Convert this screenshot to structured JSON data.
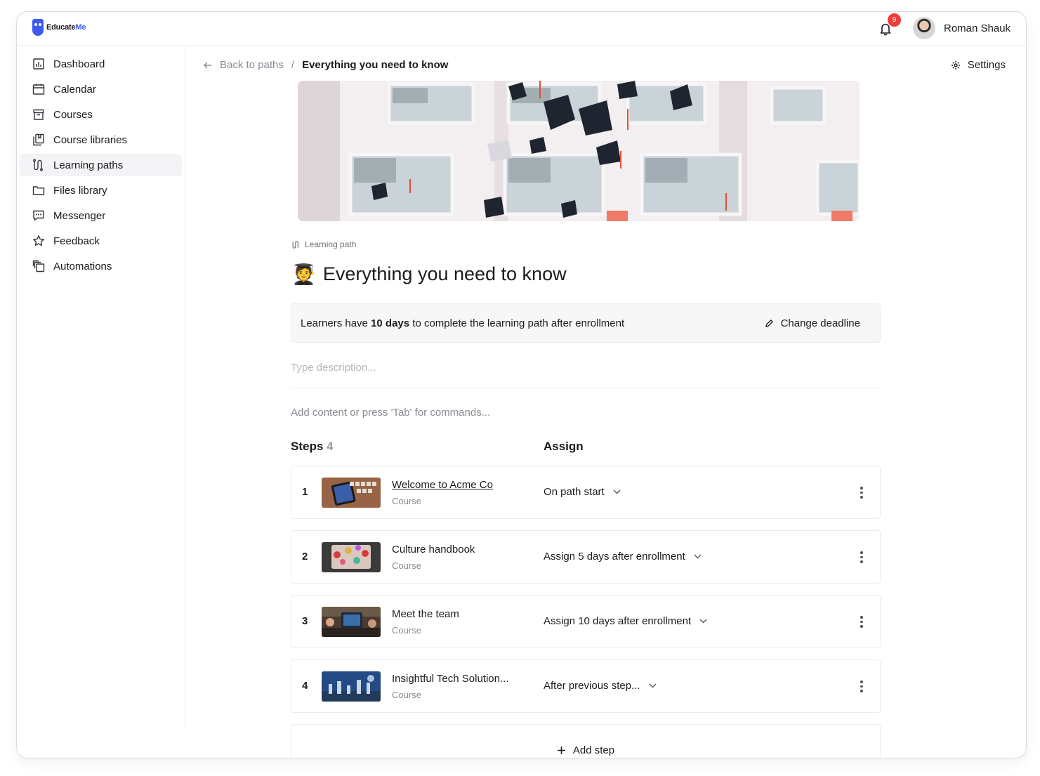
{
  "app": {
    "logo_text_main": "Educate",
    "logo_text_accent": "Me",
    "notifications_count": "9",
    "user_name": "Roman Shauk"
  },
  "sidebar": {
    "items": [
      {
        "label": "Dashboard",
        "icon": "dashboard-icon"
      },
      {
        "label": "Calendar",
        "icon": "calendar-icon"
      },
      {
        "label": "Courses",
        "icon": "courses-icon"
      },
      {
        "label": "Course libraries",
        "icon": "library-icon"
      },
      {
        "label": "Learning paths",
        "icon": "path-icon",
        "active": true
      },
      {
        "label": "Files library",
        "icon": "folder-icon"
      },
      {
        "label": "Messenger",
        "icon": "chat-icon"
      },
      {
        "label": "Feedback",
        "icon": "star-icon"
      },
      {
        "label": "Automations",
        "icon": "automation-icon"
      }
    ]
  },
  "breadcrumb": {
    "back_label": "Back to paths",
    "separator": "/",
    "current": "Everything you need to know"
  },
  "settings_label": "Settings",
  "path": {
    "tag": "Learning path",
    "emoji": "🧑‍🎓",
    "title": "Everything you need to know",
    "deadline_prefix": "Learners have ",
    "deadline_value": "10 days",
    "deadline_suffix": " to complete the learning path after enrollment",
    "change_deadline_label": "Change deadline",
    "description_placeholder": "Type description...",
    "content_hint": "Add content or press 'Tab' for commands..."
  },
  "steps": {
    "header_label": "Steps",
    "count": "4",
    "assign_header": "Assign",
    "items": [
      {
        "number": "1",
        "name": "Welcome to Acme Co",
        "type": "Course",
        "assign": "On path start"
      },
      {
        "number": "2",
        "name": "Culture handbook",
        "type": "Course",
        "assign": "Assign 5 days after enrollment"
      },
      {
        "number": "3",
        "name": "Meet the team",
        "type": "Course",
        "assign": "Assign 10 days after enrollment"
      },
      {
        "number": "4",
        "name": "Insightful Tech Solution...",
        "type": "Course",
        "assign": "After previous step..."
      }
    ],
    "add_step_label": "Add step"
  },
  "colors": {
    "accent": "#3d5af1",
    "badge": "#ef3b3b",
    "active_nav_bg": "#f4f4f6"
  }
}
